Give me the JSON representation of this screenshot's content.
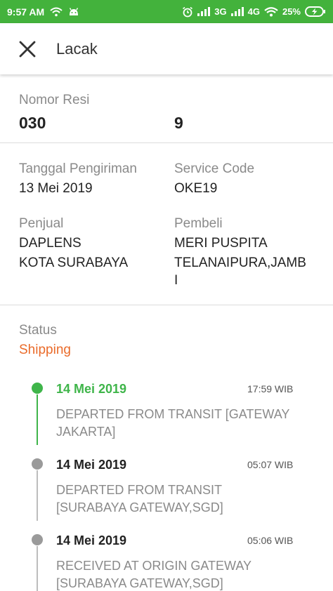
{
  "status_bar": {
    "time": "9:57 AM",
    "network_1": "3G",
    "network_2": "4G",
    "battery": "25%"
  },
  "app_bar": {
    "title": "Lacak"
  },
  "resi": {
    "label": "Nomor Resi",
    "value_part_1": "030",
    "value_part_2": "9"
  },
  "details": {
    "tanggal_label": "Tanggal Pengiriman",
    "tanggal_value": "13 Mei 2019",
    "service_label": "Service Code",
    "service_value": "OKE19",
    "penjual_label": "Penjual",
    "penjual_name": "DAPLENS",
    "penjual_city": "KOTA SURABAYA",
    "pembeli_label": "Pembeli",
    "pembeli_name": "MERI PUSPITA",
    "pembeli_city_1": "TELANAIPURA,JAMB",
    "pembeli_city_2": "I"
  },
  "status": {
    "label": "Status",
    "value": "Shipping",
    "value_color": "#ea6b2a"
  },
  "timeline": [
    {
      "date": "14 Mei 2019",
      "time": "17:59 WIB",
      "desc_1": "DEPARTED FROM TRANSIT [GATEWAY",
      "desc_2": "JAKARTA]",
      "active": true
    },
    {
      "date": "14 Mei 2019",
      "time": "05:07 WIB",
      "desc_1": "DEPARTED FROM TRANSIT",
      "desc_2": "[SURABAYA GATEWAY,SGD]",
      "active": false
    },
    {
      "date": "14 Mei 2019",
      "time": "05:06 WIB",
      "desc_1": "RECEIVED AT ORIGIN GATEWAY",
      "desc_2": "[SURABAYA GATEWAY,SGD]",
      "active": false
    }
  ],
  "colors": {
    "status_bar": "#43b23c",
    "active": "#3fb54a",
    "inactive": "#9a9a9a"
  }
}
